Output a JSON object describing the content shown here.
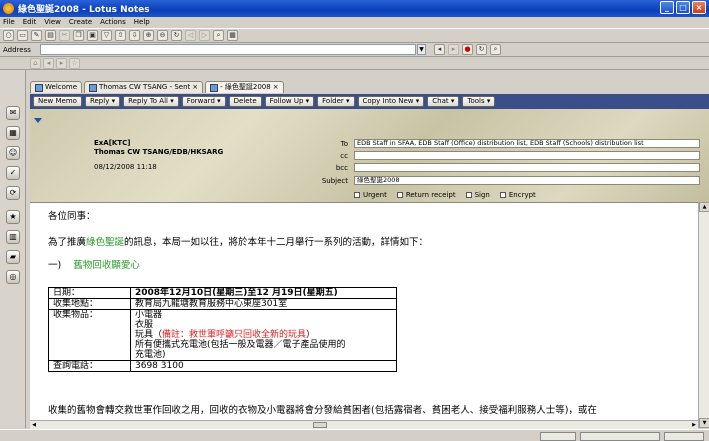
{
  "window": {
    "title": "綠色聖誕2008 - Lotus Notes"
  },
  "menu": [
    "File",
    "Edit",
    "View",
    "Create",
    "Actions",
    "Help"
  ],
  "address": {
    "label": "Address",
    "value": ""
  },
  "tabs": [
    {
      "label": "Welcome"
    },
    {
      "label": "Thomas CW TSANG - Sent"
    },
    {
      "label": "- 綠色聖誕2008"
    }
  ],
  "actions": [
    "New Memo",
    "Reply",
    "Reply To All",
    "Forward",
    "Delete",
    "Follow Up",
    "Folder",
    "Copy Into New",
    "Chat",
    "Tools"
  ],
  "header": {
    "org": "ExA[KTC]",
    "sender": "Thomas CW TSANG/EDB/HKSARG",
    "datetime": "08/12/2008 11:18",
    "to_label": "To",
    "to": "EDB Staff in SFAA, EDB Staff (Office) distribution list, EDB Staff (Schools) distribution list",
    "cc_label": "cc",
    "cc": "",
    "bcc_label": "bcc",
    "bcc": "",
    "subject_label": "Subject",
    "subject": "綠色聖誕2008",
    "options": [
      "Urgent",
      "Return receipt",
      "Sign",
      "Encrypt"
    ]
  },
  "body": {
    "greeting": "各位同事：",
    "intro_a": "為了推廣",
    "intro_green": "綠色聖誕",
    "intro_b": "的訊息，本局一如以往，將於本年十二月舉行一系列的活動，詳情如下：",
    "section_num": "一)",
    "section_title": "舊物回收顯愛心",
    "table": {
      "date_label": "日期：",
      "date_value": "2008年12月10日(星期三)至12 月19日(星期五)",
      "venue_label": "收集地點：",
      "venue_value": "教育局九龍塘教育服務中心東座301室",
      "items_label": "收集物品：",
      "items": {
        "line1": "小電器",
        "line2": "衣服",
        "line3_a": "玩具（",
        "line3_red": "備註：救世軍呼籲只回收全新的玩具",
        "line3_b": "）",
        "line4": "所有便攜式充電池(包括一般及電器／電子產品使用的",
        "line5": "充電池)"
      },
      "phone_label": "查詢電話：",
      "phone_value": "3698 3100"
    },
    "closing": "收集的舊物會轉交救世軍作回收之用，回收的衣物及小電器將會分發給貧困者(包括露宿者、貧困老人、接受福利服務人士等)，或在"
  }
}
